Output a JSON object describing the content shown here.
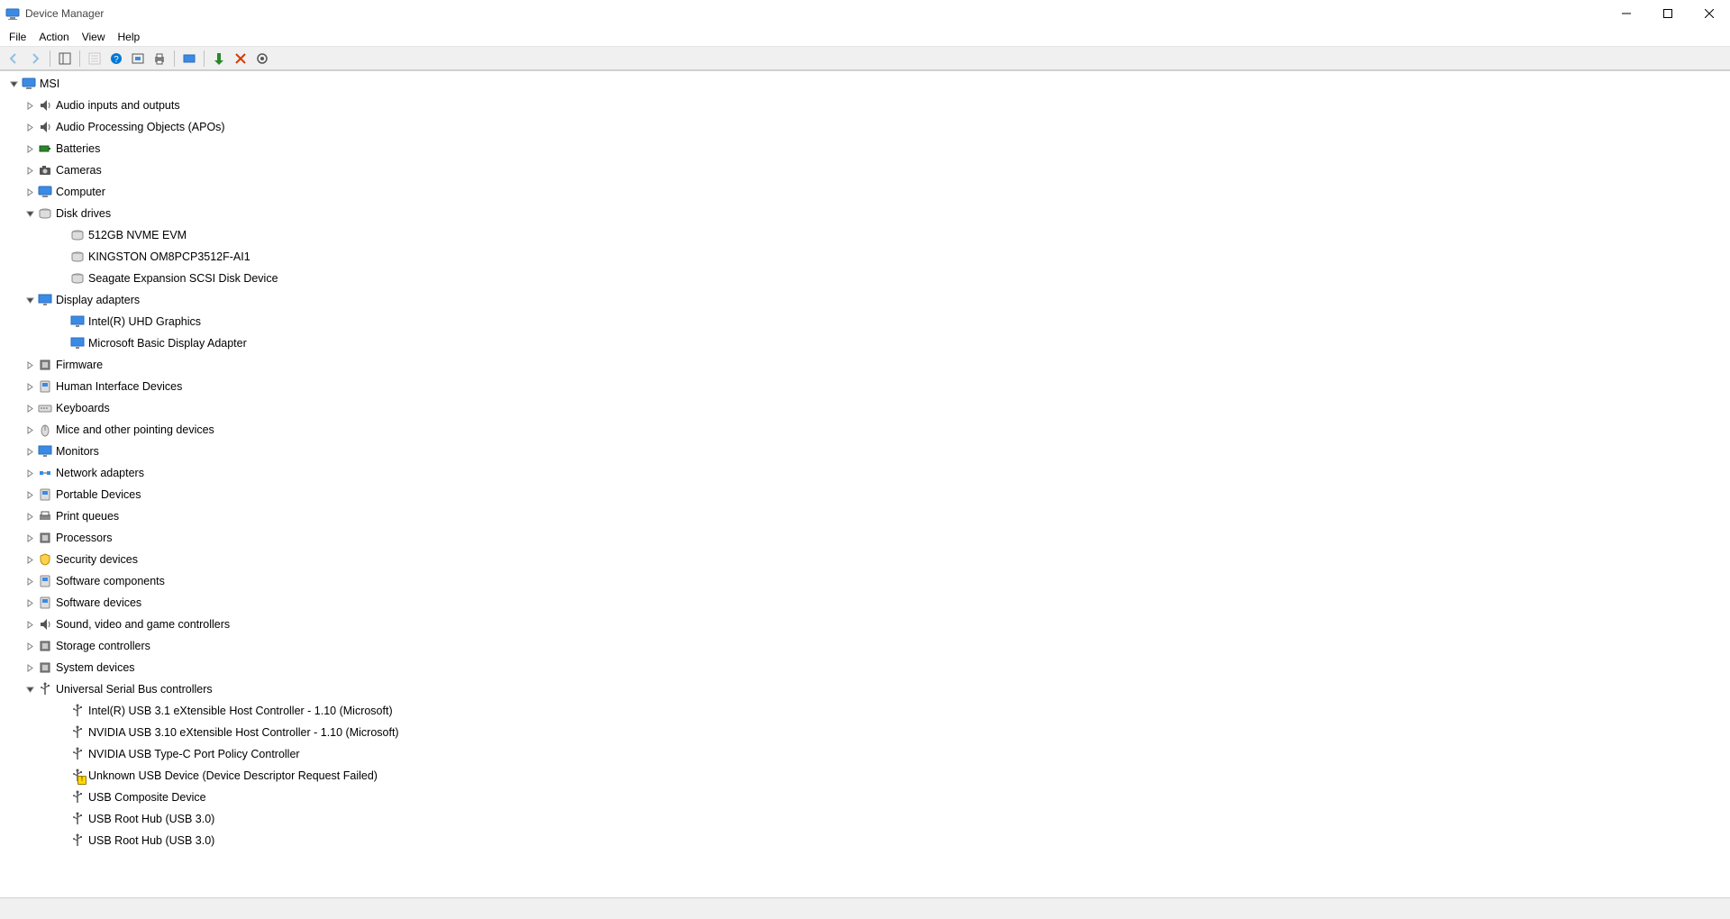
{
  "window": {
    "title": "Device Manager"
  },
  "menu": {
    "file": "File",
    "action": "Action",
    "view": "View",
    "help": "Help"
  },
  "toolbar": {
    "back": "Back",
    "forward": "Forward",
    "show_hide": "Show/Hide console tree",
    "properties": "Properties",
    "help": "Help",
    "refresh": "Refresh",
    "print": "Print",
    "enable": "Enable",
    "update": "Update driver",
    "uninstall": "Uninstall",
    "scan": "Scan for hardware changes"
  },
  "tree": {
    "root": {
      "label": "MSI",
      "icon": "computer-icon"
    },
    "categories": [
      {
        "label": "Audio inputs and outputs",
        "icon": "audio-icon",
        "expanded": false
      },
      {
        "label": "Audio Processing Objects (APOs)",
        "icon": "apo-icon",
        "expanded": false
      },
      {
        "label": "Batteries",
        "icon": "battery-icon",
        "expanded": false
      },
      {
        "label": "Cameras",
        "icon": "camera-icon",
        "expanded": false
      },
      {
        "label": "Computer",
        "icon": "computer-icon",
        "expanded": false
      },
      {
        "label": "Disk drives",
        "icon": "disk-icon",
        "expanded": true,
        "children": [
          {
            "label": "512GB NVME EVM",
            "icon": "disk-icon"
          },
          {
            "label": "KINGSTON OM8PCP3512F-AI1",
            "icon": "disk-icon"
          },
          {
            "label": "Seagate Expansion SCSI Disk Device",
            "icon": "disk-icon"
          }
        ]
      },
      {
        "label": "Display adapters",
        "icon": "display-icon",
        "expanded": true,
        "children": [
          {
            "label": "Intel(R) UHD Graphics",
            "icon": "display-icon"
          },
          {
            "label": "Microsoft Basic Display Adapter",
            "icon": "display-icon"
          }
        ]
      },
      {
        "label": "Firmware",
        "icon": "firmware-icon",
        "expanded": false
      },
      {
        "label": "Human Interface Devices",
        "icon": "hid-icon",
        "expanded": false
      },
      {
        "label": "Keyboards",
        "icon": "keyboard-icon",
        "expanded": false
      },
      {
        "label": "Mice and other pointing devices",
        "icon": "mouse-icon",
        "expanded": false
      },
      {
        "label": "Monitors",
        "icon": "monitor-icon",
        "expanded": false
      },
      {
        "label": "Network adapters",
        "icon": "network-icon",
        "expanded": false
      },
      {
        "label": "Portable Devices",
        "icon": "portable-icon",
        "expanded": false
      },
      {
        "label": "Print queues",
        "icon": "printer-icon",
        "expanded": false
      },
      {
        "label": "Processors",
        "icon": "cpu-icon",
        "expanded": false
      },
      {
        "label": "Security devices",
        "icon": "security-icon",
        "expanded": false
      },
      {
        "label": "Software components",
        "icon": "software-icon",
        "expanded": false
      },
      {
        "label": "Software devices",
        "icon": "software-icon",
        "expanded": false
      },
      {
        "label": "Sound, video and game controllers",
        "icon": "sound-icon",
        "expanded": false
      },
      {
        "label": "Storage controllers",
        "icon": "storage-icon",
        "expanded": false
      },
      {
        "label": "System devices",
        "icon": "system-icon",
        "expanded": false
      },
      {
        "label": "Universal Serial Bus controllers",
        "icon": "usb-icon",
        "expanded": true,
        "children": [
          {
            "label": "Intel(R) USB 3.1 eXtensible Host Controller - 1.10 (Microsoft)",
            "icon": "usb-icon"
          },
          {
            "label": "NVIDIA USB 3.10 eXtensible Host Controller - 1.10 (Microsoft)",
            "icon": "usb-icon"
          },
          {
            "label": "NVIDIA USB Type-C Port Policy Controller",
            "icon": "usb-icon"
          },
          {
            "label": "Unknown USB Device (Device Descriptor Request Failed)",
            "icon": "usb-icon",
            "warn": true
          },
          {
            "label": "USB Composite Device",
            "icon": "usb-icon"
          },
          {
            "label": "USB Root Hub (USB 3.0)",
            "icon": "usb-icon"
          },
          {
            "label": "USB Root Hub (USB 3.0)",
            "icon": "usb-icon"
          }
        ]
      }
    ]
  }
}
